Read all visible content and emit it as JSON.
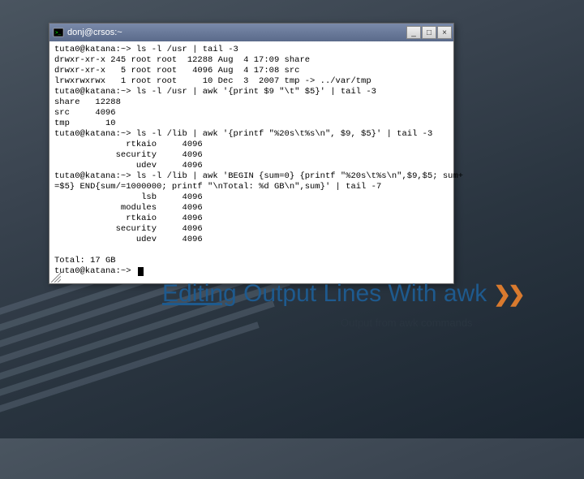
{
  "window": {
    "title": "donj@crsos:~",
    "icon_name": "terminal-icon"
  },
  "terminal": {
    "lines": [
      "tuta0@katana:~> ls -l /usr | tail -3",
      "drwxr-xr-x 245 root root  12288 Aug  4 17:09 share",
      "drwxr-xr-x   5 root root   4096 Aug  4 17:08 src",
      "lrwxrwxrwx   1 root root     10 Dec  3  2007 tmp -> ../var/tmp",
      "tuta0@katana:~> ls -l /usr | awk '{print $9 \"\\t\" $5}' | tail -3",
      "share   12288",
      "src     4096",
      "tmp       10",
      "tuta0@katana:~> ls -l /lib | awk '{printf \"%20s\\t%s\\n\", $9, $5}' | tail -3",
      "              rtkaio     4096",
      "            security     4096",
      "                udev     4096",
      "tuta0@katana:~> ls -l /lib | awk 'BEGIN {sum=0} {printf \"%20s\\t%s\\n\",$9,$5; sum+",
      "=$5} END{sum/=1000000; printf \"\\nTotal: %d GB\\n\",sum}' | tail -7",
      "                 lsb     4096",
      "             modules     4096",
      "              rtkaio     4096",
      "            security     4096",
      "                udev     4096",
      "",
      "Total: 17 GB",
      "tuta0@katana:~> "
    ]
  },
  "heading": {
    "word1": "Editing",
    "rest": " Output Lines With awk"
  },
  "caption": "Output from awk commands",
  "win_buttons": {
    "minimize": "_",
    "maximize": "□",
    "close": "×"
  }
}
